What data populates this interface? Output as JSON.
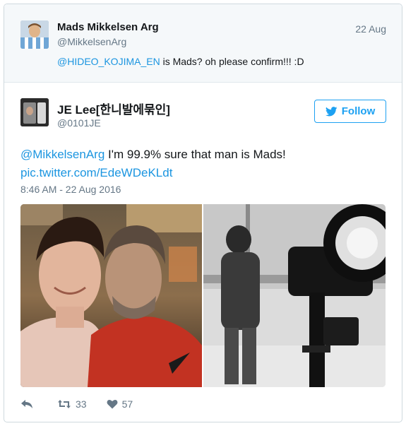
{
  "parent_tweet": {
    "name": "Mads Mikkelsen Arg",
    "handle": "@MikkelsenArg",
    "date": "22 Aug",
    "mention": "@HIDEO_KOJIMA_EN",
    "text": " is Mads? oh please confirm!!! :D"
  },
  "tweet": {
    "name": "JE Lee[한니발에묶인]",
    "handle": "@0101JE",
    "follow_label": "Follow",
    "mention": "@MikkelsenArg",
    "text": " I'm 99.9% sure that man is Mads!",
    "link": "pic.twitter.com/EdeWDeKLdt",
    "timestamp": "8:46 AM - 22 Aug 2016",
    "retweets": "33",
    "likes": "57"
  },
  "colors": {
    "link": "#1b95e0",
    "accent": "#1da1f2",
    "muted": "#657786"
  },
  "icons": [
    "twitter-bird-icon",
    "reply-icon",
    "retweet-icon",
    "heart-icon"
  ]
}
